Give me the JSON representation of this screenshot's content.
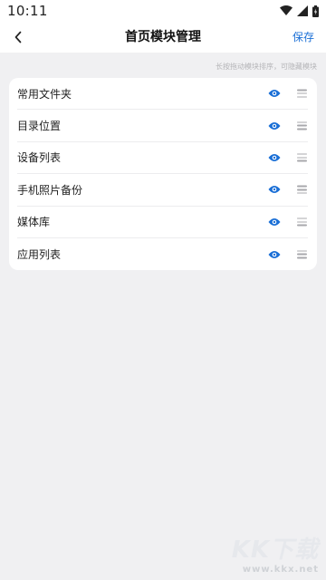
{
  "status_bar": {
    "time": "10:11"
  },
  "header": {
    "title": "首页模块管理",
    "save_label": "保存"
  },
  "hint": "长按拖动模块排序，可隐藏模块",
  "modules": [
    {
      "label": "常用文件夹",
      "visible": true
    },
    {
      "label": "目录位置",
      "visible": true
    },
    {
      "label": "设备列表",
      "visible": true
    },
    {
      "label": "手机照片备份",
      "visible": true
    },
    {
      "label": "媒体库",
      "visible": true
    },
    {
      "label": "应用列表",
      "visible": true
    }
  ],
  "watermark": {
    "logo": "KK下载",
    "url": "www.kkx.net"
  },
  "colors": {
    "accent": "#1a6fd6",
    "background": "#f0f0f2",
    "card": "#ffffff"
  },
  "icons": {
    "visibility": "eye-icon",
    "reorder": "drag-handle-icon",
    "back": "chevron-left-icon"
  }
}
